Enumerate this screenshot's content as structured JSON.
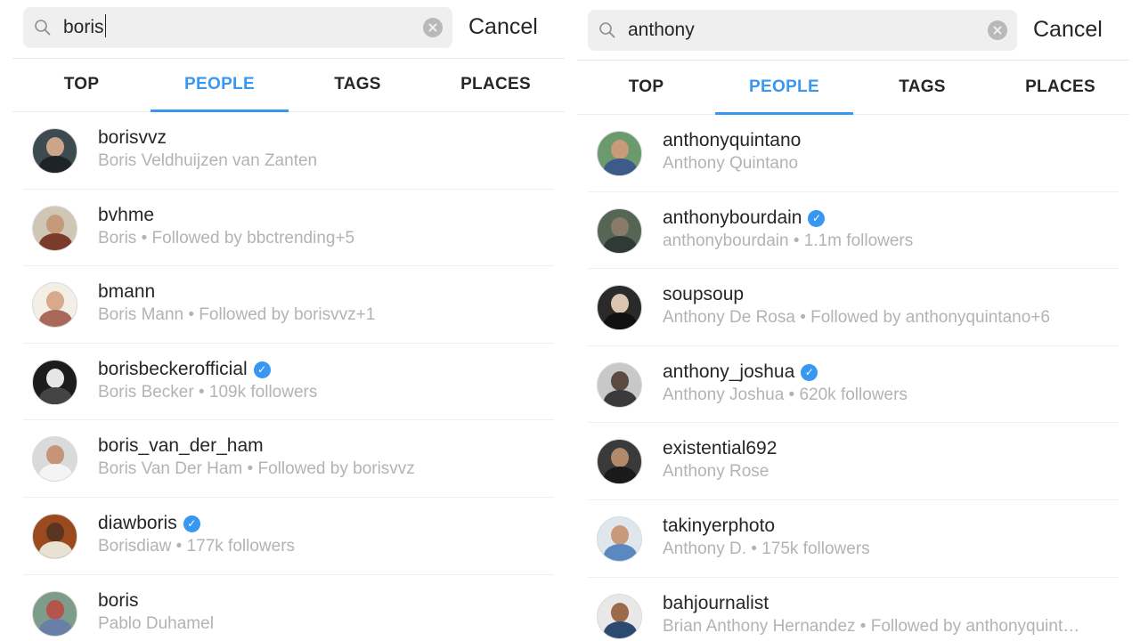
{
  "left": {
    "query": "boris",
    "cancel": "Cancel",
    "tabs": [
      "TOP",
      "PEOPLE",
      "TAGS",
      "PLACES"
    ],
    "active_tab": "PEOPLE",
    "results": [
      {
        "username": "borisvvz",
        "subtitle": "Boris Veldhuijzen van Zanten",
        "verified": false
      },
      {
        "username": "bvhme",
        "subtitle": "Boris • Followed by bbctrending+5",
        "verified": false
      },
      {
        "username": "bmann",
        "subtitle": "Boris Mann • Followed by borisvvz+1",
        "verified": false
      },
      {
        "username": "borisbeckerofficial",
        "subtitle": "Boris Becker • 109k followers",
        "verified": true
      },
      {
        "username": "boris_van_der_ham",
        "subtitle": "Boris Van Der Ham • Followed by borisvvz",
        "verified": false
      },
      {
        "username": "diawboris",
        "subtitle": "Borisdiaw • 177k followers",
        "verified": true
      },
      {
        "username": "boris",
        "subtitle": "Pablo Duhamel",
        "verified": false
      }
    ]
  },
  "right": {
    "query": "anthony",
    "cancel": "Cancel",
    "tabs": [
      "TOP",
      "PEOPLE",
      "TAGS",
      "PLACES"
    ],
    "active_tab": "PEOPLE",
    "results": [
      {
        "username": "anthonyquintano",
        "subtitle": "Anthony Quintano",
        "verified": false
      },
      {
        "username": "anthonybourdain",
        "subtitle": "anthonybourdain • 1.1m followers",
        "verified": true
      },
      {
        "username": "soupsoup",
        "subtitle": "Anthony De Rosa • Followed by anthonyquintano+6",
        "verified": false
      },
      {
        "username": "anthony_joshua",
        "subtitle": "Anthony Joshua • 620k followers",
        "verified": true
      },
      {
        "username": "existential692",
        "subtitle": "Anthony Rose",
        "verified": false
      },
      {
        "username": "takinyerphoto",
        "subtitle": "Anthony D. • 175k followers",
        "verified": false
      },
      {
        "username": "bahjournalist",
        "subtitle": "Brian Anthony Hernandez • Followed by anthonyquint…",
        "verified": false
      }
    ]
  },
  "colors": {
    "accent": "#3897f0",
    "text": "#262626",
    "subtext": "#b3b3b3",
    "search_bg": "#efefef"
  }
}
